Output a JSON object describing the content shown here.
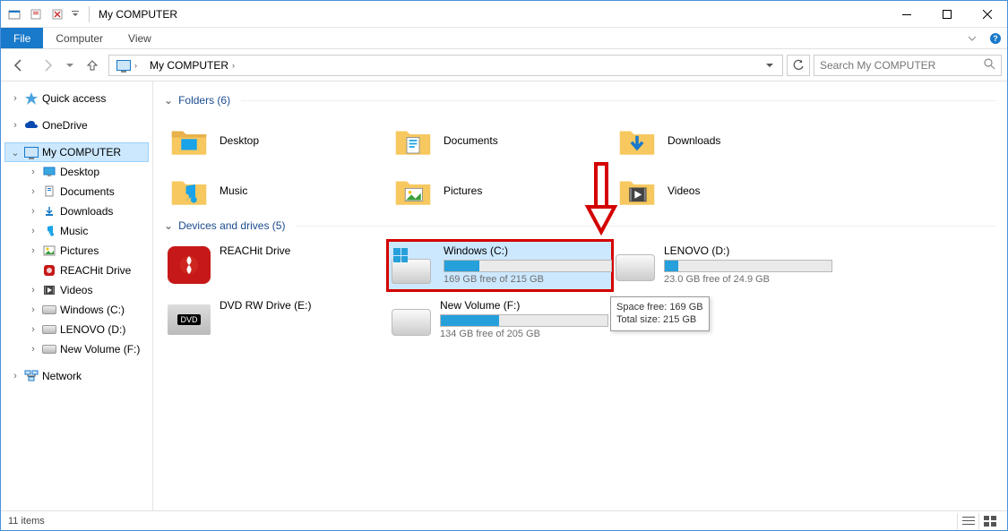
{
  "window": {
    "title": "My COMPUTER"
  },
  "ribbon": {
    "file": "File",
    "tabs": [
      "Computer",
      "View"
    ]
  },
  "breadcrumb": {
    "root_icon": "monitor",
    "current": "My COMPUTER"
  },
  "search": {
    "placeholder": "Search My COMPUTER"
  },
  "sidebar": {
    "items": [
      {
        "label": "Quick access",
        "icon": "star-icon",
        "expandable": true
      },
      {
        "label": "OneDrive",
        "icon": "onedrive-icon",
        "expandable": true
      },
      {
        "label": "My COMPUTER",
        "icon": "monitor-icon",
        "expandable": true,
        "selected": true,
        "children": [
          {
            "label": "Desktop",
            "icon": "desktop-icon"
          },
          {
            "label": "Documents",
            "icon": "documents-icon"
          },
          {
            "label": "Downloads",
            "icon": "downloads-icon"
          },
          {
            "label": "Music",
            "icon": "music-icon"
          },
          {
            "label": "Pictures",
            "icon": "pictures-icon"
          },
          {
            "label": "REACHit Drive",
            "icon": "reachit-icon"
          },
          {
            "label": "Videos",
            "icon": "videos-icon"
          },
          {
            "label": "Windows (C:)",
            "icon": "drive-icon"
          },
          {
            "label": "LENOVO (D:)",
            "icon": "drive-icon"
          },
          {
            "label": "New Volume (F:)",
            "icon": "drive-icon"
          }
        ]
      },
      {
        "label": "Network",
        "icon": "network-icon",
        "expandable": true
      }
    ]
  },
  "sections": {
    "folders": {
      "title": "Folders (6)",
      "items": [
        {
          "label": "Desktop",
          "icon": "desktop-folder-icon"
        },
        {
          "label": "Documents",
          "icon": "documents-folder-icon"
        },
        {
          "label": "Downloads",
          "icon": "downloads-folder-icon"
        },
        {
          "label": "Music",
          "icon": "music-folder-icon"
        },
        {
          "label": "Pictures",
          "icon": "pictures-folder-icon"
        },
        {
          "label": "Videos",
          "icon": "videos-folder-icon"
        }
      ]
    },
    "drives": {
      "title": "Devices and drives (5)",
      "items": [
        {
          "label": "REACHit Drive",
          "type": "app"
        },
        {
          "label": "Windows (C:)",
          "type": "drive",
          "free": "169 GB free of 215 GB",
          "fill_pct": 21,
          "selected": true,
          "highlighted": true,
          "os_flag": true
        },
        {
          "label": "LENOVO (D:)",
          "type": "drive",
          "free": "23.0 GB free of 24.9 GB",
          "fill_pct": 8
        },
        {
          "label": "DVD RW Drive (E:)",
          "type": "optical"
        },
        {
          "label": "New Volume (F:)",
          "type": "drive",
          "free": "134 GB free of 205 GB",
          "fill_pct": 35
        }
      ]
    }
  },
  "tooltip": {
    "line1": "Space free: 169 GB",
    "line2": "Total size: 215 GB"
  },
  "status": {
    "text": "11 items"
  }
}
